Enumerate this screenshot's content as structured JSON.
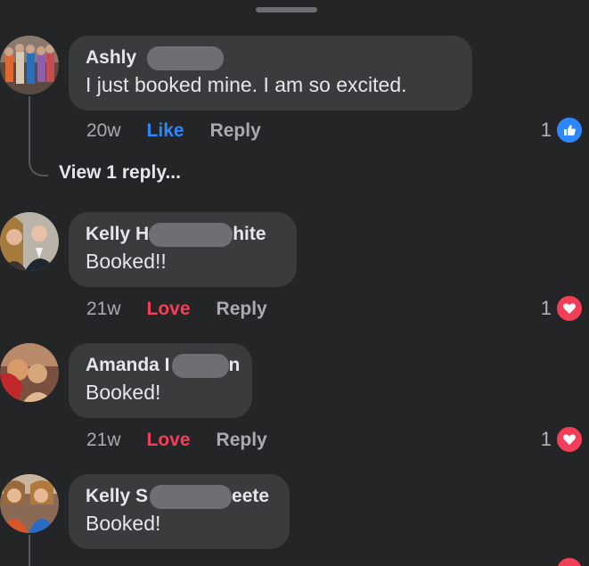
{
  "comments": [
    {
      "author_first": "Ashly",
      "author_last": "",
      "text": "I just booked mine. I am so excited.",
      "time": "20w",
      "reaction_label": "Like",
      "reply_label": "Reply",
      "reaction_count": "1",
      "reaction_type": "like-icon"
    },
    {
      "author_first": "Kelly H",
      "author_last": "hite",
      "text": "Booked!!",
      "time": "21w",
      "reaction_label": "Love",
      "reply_label": "Reply",
      "reaction_count": "1",
      "reaction_type": "heart-icon"
    },
    {
      "author_first": "Amanda I",
      "author_last": "n",
      "text": "Booked!",
      "time": "21w",
      "reaction_label": "Love",
      "reply_label": "Reply",
      "reaction_count": "1",
      "reaction_type": "heart-icon"
    },
    {
      "author_first": "Kelly S",
      "author_last": "eete",
      "text": "Booked!",
      "time": "",
      "reaction_label": "",
      "reply_label": "",
      "reaction_count": "",
      "reaction_type": "heart-icon"
    }
  ],
  "view_replies_label": "View 1 reply...",
  "colors": {
    "background": "#242526",
    "bubble": "#3a3b3c",
    "like": "#2d88ff",
    "love": "#f33e58",
    "muted": "#a8abaf"
  }
}
